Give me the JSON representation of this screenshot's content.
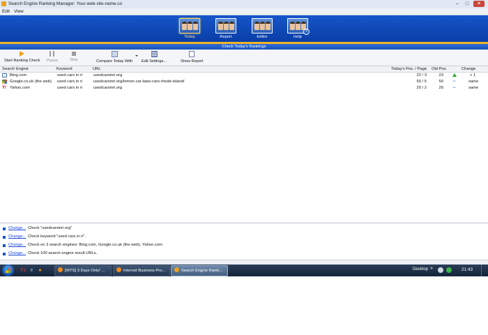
{
  "window": {
    "title": "Search Engine Ranking Manager: Your-web-site-name.co",
    "controls": {
      "minimize": "–",
      "maximize": "□",
      "close": "✕"
    }
  },
  "menu": [
    "Edit",
    "View"
  ],
  "nav": [
    {
      "label": "Today",
      "active": true
    },
    {
      "label": "Report",
      "active": false
    },
    {
      "label": "Editor",
      "active": false
    },
    {
      "label": "Help",
      "active": false
    }
  ],
  "subheader": "Check Today's Rankings",
  "toolbar": {
    "start": "Start Ranking Check",
    "pause": "Pause",
    "stop": "Stop",
    "compare": "Compare Today With",
    "edit": "Edit Settings...",
    "report": "Show Report"
  },
  "table": {
    "headers": {
      "engine": "Search Engine",
      "keyword": "Keyword",
      "url": "URL",
      "pos": "Today's Pos. / Page",
      "old": "Old Pos.",
      "change": "Change"
    },
    "rows": [
      {
        "engine": "Bing.com",
        "keyword": "used cars in ri",
        "url": "usedcarsinri.org",
        "pos": "22 / 3",
        "old": "23",
        "change": "+ 1",
        "trend": "up"
      },
      {
        "engine": "Google.co.uk (the web)",
        "keyword": "used cars in ri",
        "url": "usedcarsinri.org/lemon-car-laws-cars-rhode-island/",
        "pos": "50 / 5",
        "old": "50",
        "change": "same",
        "trend": "same"
      },
      {
        "engine": "Yahoo.com",
        "keyword": "used cars in ri",
        "url": "usedcarsinri.org",
        "pos": "20 / 2",
        "old": "20",
        "change": "same",
        "trend": "same"
      }
    ]
  },
  "log": [
    {
      "link": "Change...",
      "text": "Check \"usedcarsinri.org\""
    },
    {
      "link": "Change...",
      "text": "Check keyword \"used cars in ri\"."
    },
    {
      "link": "Change...",
      "text": "Check on 3 search engines: Bing.com, Google.co.uk (the web), Yahoo.com."
    },
    {
      "link": "Change...",
      "text": "Check 100 search engine result URLs."
    }
  ],
  "taskbar": {
    "tasks": [
      {
        "label": "[WTS] 3 Days Only! ..."
      },
      {
        "label": "Internet Business Pro..."
      },
      {
        "label": "Search Engine Ranki..."
      }
    ],
    "desktop": "Desktop",
    "chevron": "»",
    "time": "21:43"
  },
  "icons": {
    "start_ranking": "play-icon",
    "pause": "pause-icon",
    "stop": "stop-icon",
    "change_up": "arrow-up-icon",
    "change_same": "arrow-left-right-icon"
  },
  "colors": {
    "banner": "#0a3ea6",
    "accent_stripe": "#f2b428",
    "link": "#1a44d8",
    "up_arrow": "#27a52c",
    "same_arrow": "#2a5bd2"
  }
}
